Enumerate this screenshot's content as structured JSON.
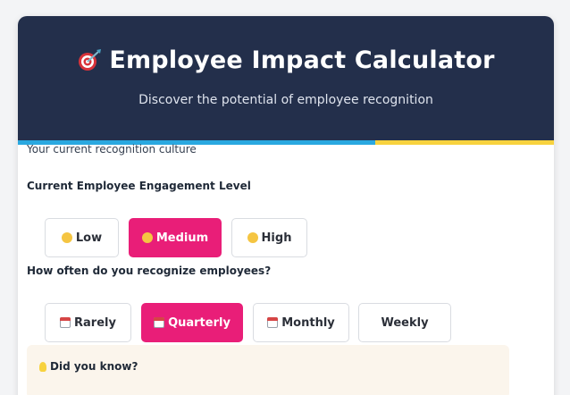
{
  "header": {
    "title": "Employee Impact Calculator",
    "subtitle": "Discover the potential of employee recognition",
    "icon": "target-dart-icon"
  },
  "section_caption": "Your current recognition culture",
  "engagement": {
    "label": "Current Employee Engagement Level",
    "options": [
      {
        "label": "Low",
        "icon": "neutral-face-icon",
        "selected": false
      },
      {
        "label": "Medium",
        "icon": "slight-smile-icon",
        "selected": true
      },
      {
        "label": "High",
        "icon": "smile-icon",
        "selected": false
      }
    ]
  },
  "frequency": {
    "label": "How often do you recognize employees?",
    "options": [
      {
        "label": "Rarely",
        "icon": "calendar-icon",
        "selected": false
      },
      {
        "label": "Quarterly",
        "icon": "calendar-icon",
        "selected": true
      },
      {
        "label": "Monthly",
        "icon": "calendar-icon",
        "selected": false
      },
      {
        "label": "Weekly",
        "icon": "",
        "selected": false
      }
    ]
  },
  "did_you_know": {
    "label": "Did you know?",
    "icon": "lightbulb-icon"
  },
  "colors": {
    "header_bg": "#232f4b",
    "accent_pink": "#e91e78",
    "stripe_blue": "#2aa8e0",
    "stripe_yellow": "#f7d23e"
  }
}
